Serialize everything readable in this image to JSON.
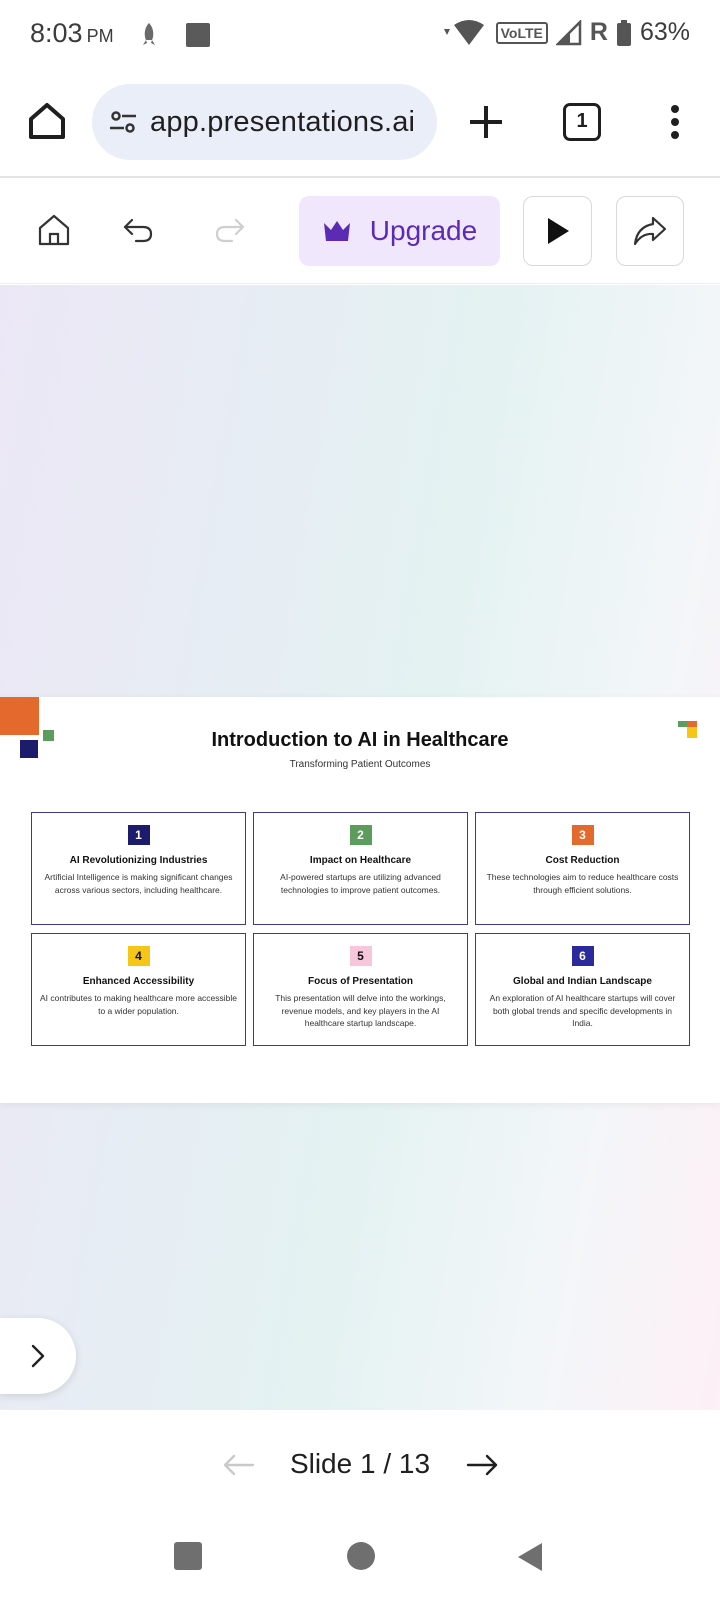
{
  "status_bar": {
    "time": "8:03",
    "ampm": "PM",
    "volte": "VoLTE",
    "roaming": "R",
    "battery": "63%"
  },
  "browser": {
    "url": "app.presentations.ai",
    "tab_count": "1"
  },
  "toolbar": {
    "upgrade_label": "Upgrade"
  },
  "slide": {
    "title": "Introduction to AI in Healthcare",
    "subtitle": "Transforming Patient Outcomes",
    "cards": [
      {
        "num": "1",
        "num_bg": "#1d1b6b",
        "num_color": "#ffffff",
        "title": "AI Revolutionizing Industries",
        "desc": "Artificial Intelligence is making significant changes across various sectors, including healthcare."
      },
      {
        "num": "2",
        "num_bg": "#5c9c5c",
        "num_color": "#ffffff",
        "title": "Impact on Healthcare",
        "desc": "AI-powered startups are utilizing advanced technologies to improve patient outcomes."
      },
      {
        "num": "3",
        "num_bg": "#e4692c",
        "num_color": "#ffffff",
        "title": "Cost Reduction",
        "desc": "These technologies aim to reduce healthcare costs through efficient solutions."
      },
      {
        "num": "4",
        "num_bg": "#f5c518",
        "num_color": "#111111",
        "title": "Enhanced Accessibility",
        "desc": "AI contributes to making healthcare more accessible to a wider population."
      },
      {
        "num": "5",
        "num_bg": "#f7c6da",
        "num_color": "#111111",
        "title": "Focus of Presentation",
        "desc": "This presentation will delve into the workings, revenue models, and key players in the AI healthcare startup landscape."
      },
      {
        "num": "6",
        "num_bg": "#2a2a9c",
        "num_color": "#ffffff",
        "title": "Global and Indian Landscape",
        "desc": "An exploration of AI healthcare startups will cover both global trends and specific developments in India."
      }
    ]
  },
  "slide_nav": {
    "counter": "Slide 1 / 13"
  }
}
